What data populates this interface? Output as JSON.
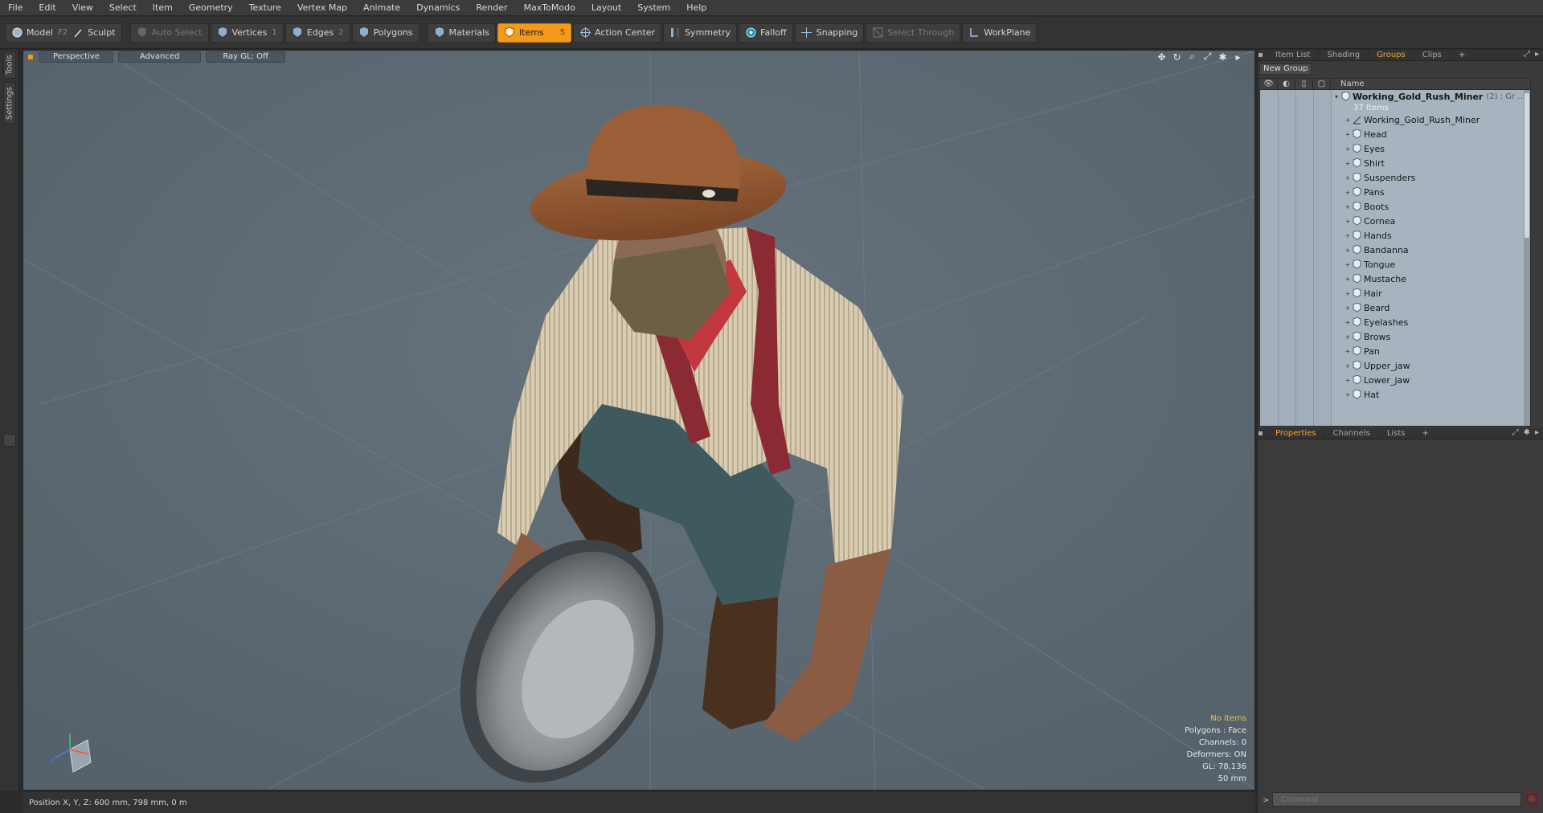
{
  "menu": [
    "File",
    "Edit",
    "View",
    "Select",
    "Item",
    "Geometry",
    "Texture",
    "Vertex Map",
    "Animate",
    "Dynamics",
    "Render",
    "MaxToModo",
    "Layout",
    "System",
    "Help"
  ],
  "toolbar": {
    "model": "Model",
    "model_key": "F2",
    "sculpt": "Sculpt",
    "auto_select": "Auto Select",
    "vertices": "Vertices",
    "vertices_key": "1",
    "edges": "Edges",
    "edges_key": "2",
    "polygons": "Polygons",
    "materials": "Materials",
    "items": "Items",
    "items_key": "5",
    "action_center": "Action Center",
    "symmetry": "Symmetry",
    "falloff": "Falloff",
    "snapping": "Snapping",
    "select_through": "Select Through",
    "workplane": "WorkPlane"
  },
  "left_tabs": {
    "tools": "Tools",
    "settings": "Settings"
  },
  "viewport": {
    "projection": "Perspective",
    "shading": "Advanced",
    "raygl": "Ray GL: Off",
    "info": {
      "items": "No Items",
      "polygons": "Polygons : Face",
      "channels": "Channels: 0",
      "deformers": "Deformers: ON",
      "gl": "GL: 78,136",
      "focal": "50 mm"
    }
  },
  "status": {
    "position": "Position X, Y, Z:   600 mm, 798 mm, 0 m"
  },
  "panel_tabs": [
    "Item List",
    "Shading",
    "Groups",
    "Clips"
  ],
  "panel_active": "Groups",
  "groups": {
    "new_group": "New Group",
    "column_name": "Name",
    "root": {
      "name": "Working_Gold_Rush_Miner",
      "suffix": "(2) : Gr ...",
      "count": "37 Items"
    },
    "items": [
      "Working_Gold_Rush_Miner",
      "Head",
      "Eyes",
      "Shirt",
      "Suspenders",
      "Pans",
      "Boots",
      "Cornea",
      "Hands",
      "Bandanna",
      "Tongue",
      "Mustache",
      "Hair",
      "Beard",
      "Eyelashes",
      "Brows",
      "Pan",
      "Upper_jaw",
      "Lower_jaw",
      "Hat"
    ]
  },
  "props_tabs": [
    "Properties",
    "Channels",
    "Lists"
  ],
  "command": {
    "placeholder": "Command"
  },
  "colors": {
    "accent": "#f39a1d",
    "viewport_bg": "#5e6b74",
    "list_bg": "#a7b4c0"
  }
}
